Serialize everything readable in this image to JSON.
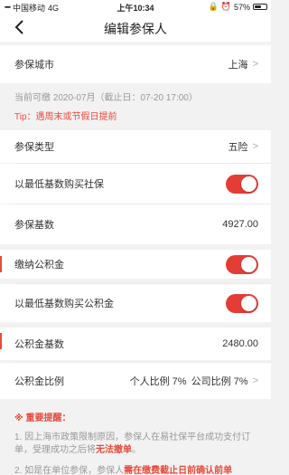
{
  "status": {
    "carrier": "中国移动",
    "network": "4G",
    "time": "上午10:34",
    "battery": "57%",
    "battery_level": 0.57
  },
  "nav": {
    "title": "编辑参保人"
  },
  "city": {
    "label": "参保城市",
    "value": "上海"
  },
  "info": {
    "period_text": "当前可缴 2020-07月（截止日：07-20 17:00）",
    "tip": "Tip：遇周末或节假日提前"
  },
  "insurance_type": {
    "label": "参保类型",
    "value": "五险"
  },
  "min_base_social": {
    "label": "以最低基数购买社保",
    "on": true
  },
  "base": {
    "label": "参保基数",
    "value": "4927.00"
  },
  "pay_fund": {
    "label": "缴纳公积金",
    "on": true
  },
  "min_base_fund": {
    "label": "以最低基数购买公积金",
    "on": true
  },
  "fund_base": {
    "label": "公积金基数",
    "value": "2480.00"
  },
  "fund_ratio": {
    "label": "公积金比例",
    "personal": "个人比例 7%",
    "company": "公司比例 7%"
  },
  "notice": {
    "head": "※ 重要提醒：",
    "item1_pre": "1. 因上海市政策限制原因，参保人在易社保平台成功支付订单，受理成功之后将",
    "item1_em": "无法撤单",
    "item1_post": "。",
    "item2_pre": "2. 如是在单位参保，参保人",
    "item2_em": "需在缴费截止日前确认前单"
  },
  "colors": {
    "accent": "#e43d36",
    "tip": "#e84a3b"
  },
  "icons": {
    "back": "chevron-left-icon",
    "chevron": "chevron-right-icon",
    "lock": "lock-icon",
    "alarm": "alarm-icon"
  }
}
